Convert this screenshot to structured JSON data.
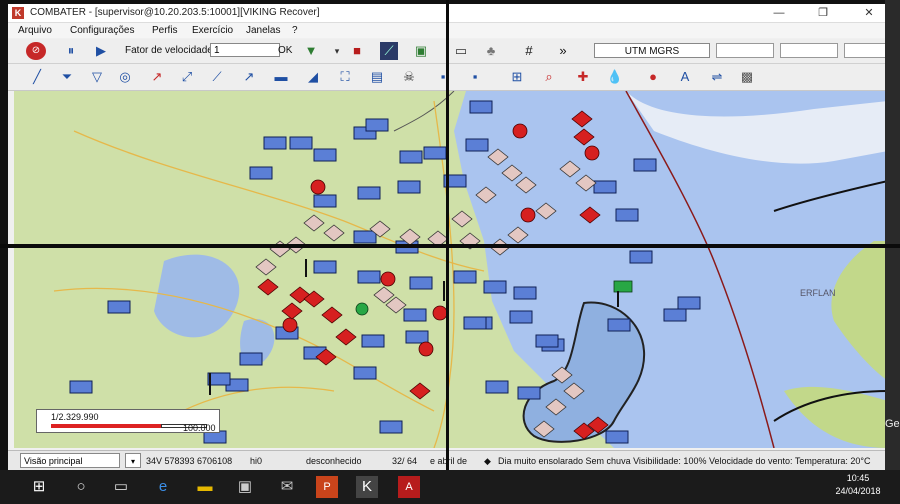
{
  "window": {
    "title": "COMBATER - [supervisor@10.20.203.5:10001][VIKING Recover]",
    "logo_letter": "K",
    "minimize": "—",
    "maximize": "❐",
    "close": "✕"
  },
  "menu": [
    "Arquivo",
    "Configurações",
    "Perfis",
    "Exercício",
    "Janelas",
    "?"
  ],
  "toolbar1": {
    "speed_label": "Fator de velocidade:",
    "speed_value": "1",
    "ok_label": "OK",
    "more_label": "»",
    "coord_system": "UTM MGRS"
  },
  "map": {
    "scale_ratio": "1/2.329.990",
    "scale_distance": "100.000",
    "sea_label": "ERFLAN",
    "edge_label": "Ge"
  },
  "statusbar": {
    "view_mode": "Visão principal",
    "dropdown_arrow": "▾",
    "coordinates": "34V 578393 6706108",
    "height": "hi0",
    "status": "desconhecido",
    "page": "32/ 64",
    "date_part": "e abril de",
    "weather": "Dia muito ensolarado Sem chuva  Visibilidade: 100%  Velocidade do vento:  Temperatura: 20°C"
  },
  "taskbar": {
    "time": "10:45",
    "date": "24/04/2018"
  },
  "colors": {
    "land": "#cfe0a8",
    "sea": "#aac4ef",
    "friendly_unit": "#5b7fd6",
    "hostile_unit": "#d62020",
    "neutral_unit": "#e3c7c2"
  }
}
